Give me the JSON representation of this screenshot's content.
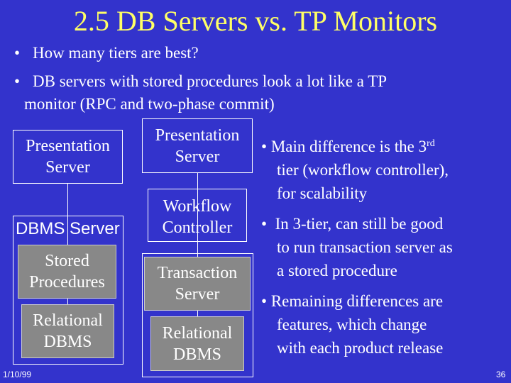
{
  "slide": {
    "title": "2.5 DB Servers vs. TP Monitors",
    "colors": {
      "background": "#3333cc",
      "title": "#ffff66",
      "text": "#ffffff",
      "inner_box": "#888888"
    },
    "top_bullets": [
      {
        "line1": "How many tiers are best?"
      },
      {
        "line1": "DB servers with stored procedures look a lot like a TP",
        "line2": "monitor (RPC and two-phase commit)"
      }
    ],
    "diagram": {
      "left": {
        "presentation": {
          "line1": "Presentation",
          "line2": "Server"
        },
        "container_label": "DBMS Server",
        "stored": {
          "line1": "Stored",
          "line2": "Procedures"
        },
        "relational": {
          "line1": "Relational",
          "line2": "DBMS"
        }
      },
      "right": {
        "presentation": {
          "line1": "Presentation",
          "line2": "Server"
        },
        "workflow": {
          "line1": "Workflow",
          "line2": "Controller"
        },
        "transaction": {
          "line1": "Transaction",
          "line2": "Server"
        },
        "relational": {
          "line1": "Relational",
          "line2": "DBMS"
        }
      }
    },
    "side_bullets": [
      {
        "line1": "Main difference is the 3",
        "sup": "rd",
        "line2": "tier (workflow controller),",
        "line3": "for scalability"
      },
      {
        "line1": "In 3-tier, can still be good",
        "line2": "to run transaction server as",
        "line3": "a stored procedure"
      },
      {
        "line1": "Remaining differences are",
        "line2": "features, which change",
        "line3": "with each product release"
      }
    ],
    "bullet_glyph": "•",
    "footer": {
      "date": "1/10/99",
      "page": "36"
    }
  }
}
